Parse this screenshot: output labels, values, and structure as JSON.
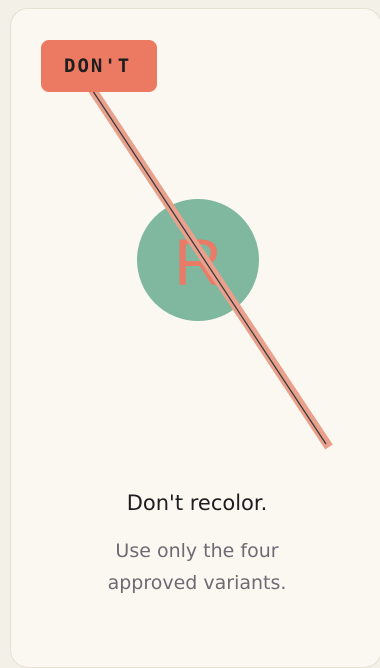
{
  "card": {
    "badge_label": "DON'T",
    "logo_letter": "R",
    "title": "Don't recolor.",
    "description": "Use only the four approved variants."
  },
  "colors": {
    "background": "#f3f0e8",
    "card": "#fbf8f1",
    "badge": "#ec7a62",
    "logo_circle": "#7fb79f",
    "logo_letter": "#ea7b66",
    "strike": "#e9a08c"
  },
  "icons": {
    "strike": "diagonal-strike-icon",
    "logo": "brand-logo-icon"
  }
}
